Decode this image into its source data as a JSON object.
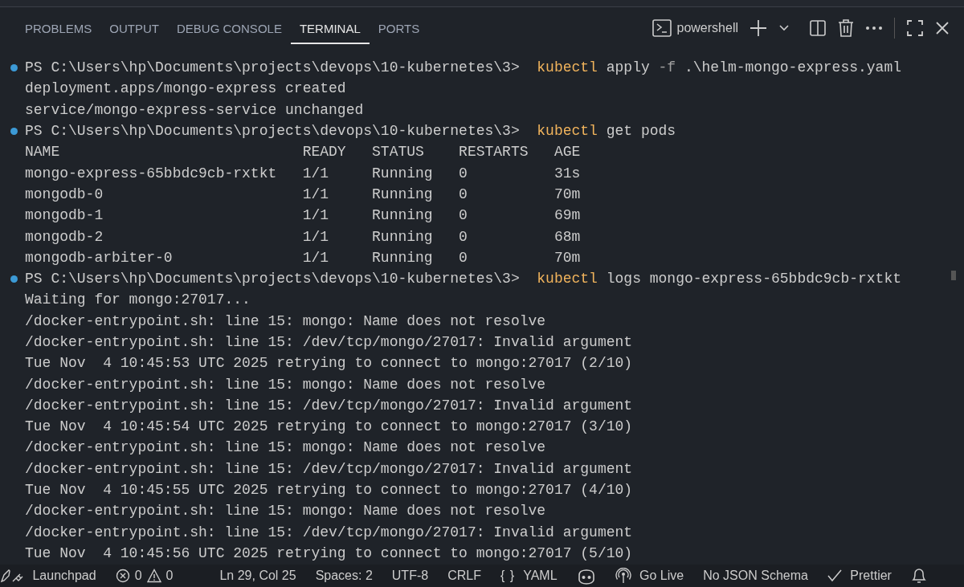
{
  "panel_tabs": [
    {
      "label": "PROBLEMS",
      "selected": false
    },
    {
      "label": "OUTPUT",
      "selected": false
    },
    {
      "label": "DEBUG CONSOLE",
      "selected": false
    },
    {
      "label": "TERMINAL",
      "selected": true
    },
    {
      "label": "PORTS",
      "selected": false
    }
  ],
  "terminal_toolbar": {
    "shell": "powershell"
  },
  "terminal": [
    {
      "kind": "prompt",
      "prompt": "PS C:\\Users\\hp\\Documents\\projects\\devops\\10-kubernetes\\3>",
      "command": "kubectl",
      "args": [
        {
          "text": "apply",
          "kind": "word"
        },
        {
          "text": "-f",
          "kind": "flag"
        },
        {
          "text": ".\\helm-mongo-express.yaml",
          "kind": "word"
        }
      ]
    },
    {
      "kind": "output",
      "text": "deployment.apps/mongo-express created"
    },
    {
      "kind": "output",
      "text": "service/mongo-express-service unchanged"
    },
    {
      "kind": "prompt",
      "prompt": "PS C:\\Users\\hp\\Documents\\projects\\devops\\10-kubernetes\\3>",
      "command": "kubectl",
      "args": [
        {
          "text": "get",
          "kind": "word"
        },
        {
          "text": "pods",
          "kind": "word"
        }
      ]
    },
    {
      "kind": "table",
      "columns": [
        "NAME",
        "READY",
        "STATUS",
        "RESTARTS",
        "AGE"
      ],
      "rows": [
        [
          "mongo-express-65bbdc9cb-rxtkt",
          "1/1",
          "Running",
          "0",
          "31s"
        ],
        [
          "mongodb-0",
          "1/1",
          "Running",
          "0",
          "70m"
        ],
        [
          "mongodb-1",
          "1/1",
          "Running",
          "0",
          "69m"
        ],
        [
          "mongodb-2",
          "1/1",
          "Running",
          "0",
          "68m"
        ],
        [
          "mongodb-arbiter-0",
          "1/1",
          "Running",
          "0",
          "70m"
        ]
      ]
    },
    {
      "kind": "prompt",
      "prompt": "PS C:\\Users\\hp\\Documents\\projects\\devops\\10-kubernetes\\3>",
      "command": "kubectl",
      "args": [
        {
          "text": "logs",
          "kind": "word"
        },
        {
          "text": "mongo-express-65bbdc9cb-rxtkt",
          "kind": "word"
        }
      ]
    },
    {
      "kind": "output",
      "text": "Waiting for mongo:27017..."
    },
    {
      "kind": "output",
      "text": "/docker-entrypoint.sh: line 15: mongo: Name does not resolve"
    },
    {
      "kind": "output",
      "text": "/docker-entrypoint.sh: line 15: /dev/tcp/mongo/27017: Invalid argument"
    },
    {
      "kind": "output",
      "text": "Tue Nov  4 10:45:53 UTC 2025 retrying to connect to mongo:27017 (2/10)"
    },
    {
      "kind": "output",
      "text": "/docker-entrypoint.sh: line 15: mongo: Name does not resolve"
    },
    {
      "kind": "output",
      "text": "/docker-entrypoint.sh: line 15: /dev/tcp/mongo/27017: Invalid argument"
    },
    {
      "kind": "output",
      "text": "Tue Nov  4 10:45:54 UTC 2025 retrying to connect to mongo:27017 (3/10)"
    },
    {
      "kind": "output",
      "text": "/docker-entrypoint.sh: line 15: mongo: Name does not resolve"
    },
    {
      "kind": "output",
      "text": "/docker-entrypoint.sh: line 15: /dev/tcp/mongo/27017: Invalid argument"
    },
    {
      "kind": "output",
      "text": "Tue Nov  4 10:45:55 UTC 2025 retrying to connect to mongo:27017 (4/10)"
    },
    {
      "kind": "output",
      "text": "/docker-entrypoint.sh: line 15: mongo: Name does not resolve"
    },
    {
      "kind": "output",
      "text": "/docker-entrypoint.sh: line 15: /dev/tcp/mongo/27017: Invalid argument"
    },
    {
      "kind": "output",
      "text": "Tue Nov  4 10:45:56 UTC 2025 retrying to connect to mongo:27017 (5/10)"
    }
  ],
  "status_bar": {
    "launchpad": "Launchpad",
    "errors": "0",
    "warnings": "0",
    "position": "Ln 29, Col 25",
    "indent": "Spaces: 2",
    "encoding": "UTF-8",
    "line_ending": "CRLF",
    "language_braces": "{ }",
    "language": "YAML",
    "go_live": "Go Live",
    "schema": "No JSON Schema",
    "prettier": "Prettier"
  }
}
